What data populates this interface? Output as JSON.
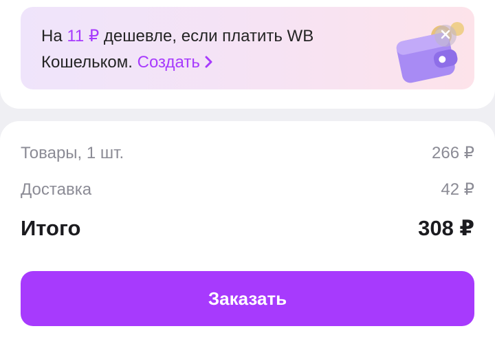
{
  "promo": {
    "text_prefix": "На",
    "discount": "11 ₽",
    "text_middle": "дешевле, если платить WB Кошельком.",
    "link_label": "Создать",
    "icons": {
      "link": "chevron-right-icon",
      "close": "close-icon",
      "art": "wallet-icon"
    }
  },
  "summary": {
    "items_label": "Товары, 1 шт.",
    "items_value": "266 ₽",
    "delivery_label": "Доставка",
    "delivery_value": "42 ₽",
    "total_label": "Итого",
    "total_value": "308 ₽"
  },
  "order_button": {
    "label": "Заказать"
  },
  "colors": {
    "accent": "#a73afd",
    "text": "#242424",
    "muted": "#8b8b95",
    "background": "#efeff3"
  }
}
